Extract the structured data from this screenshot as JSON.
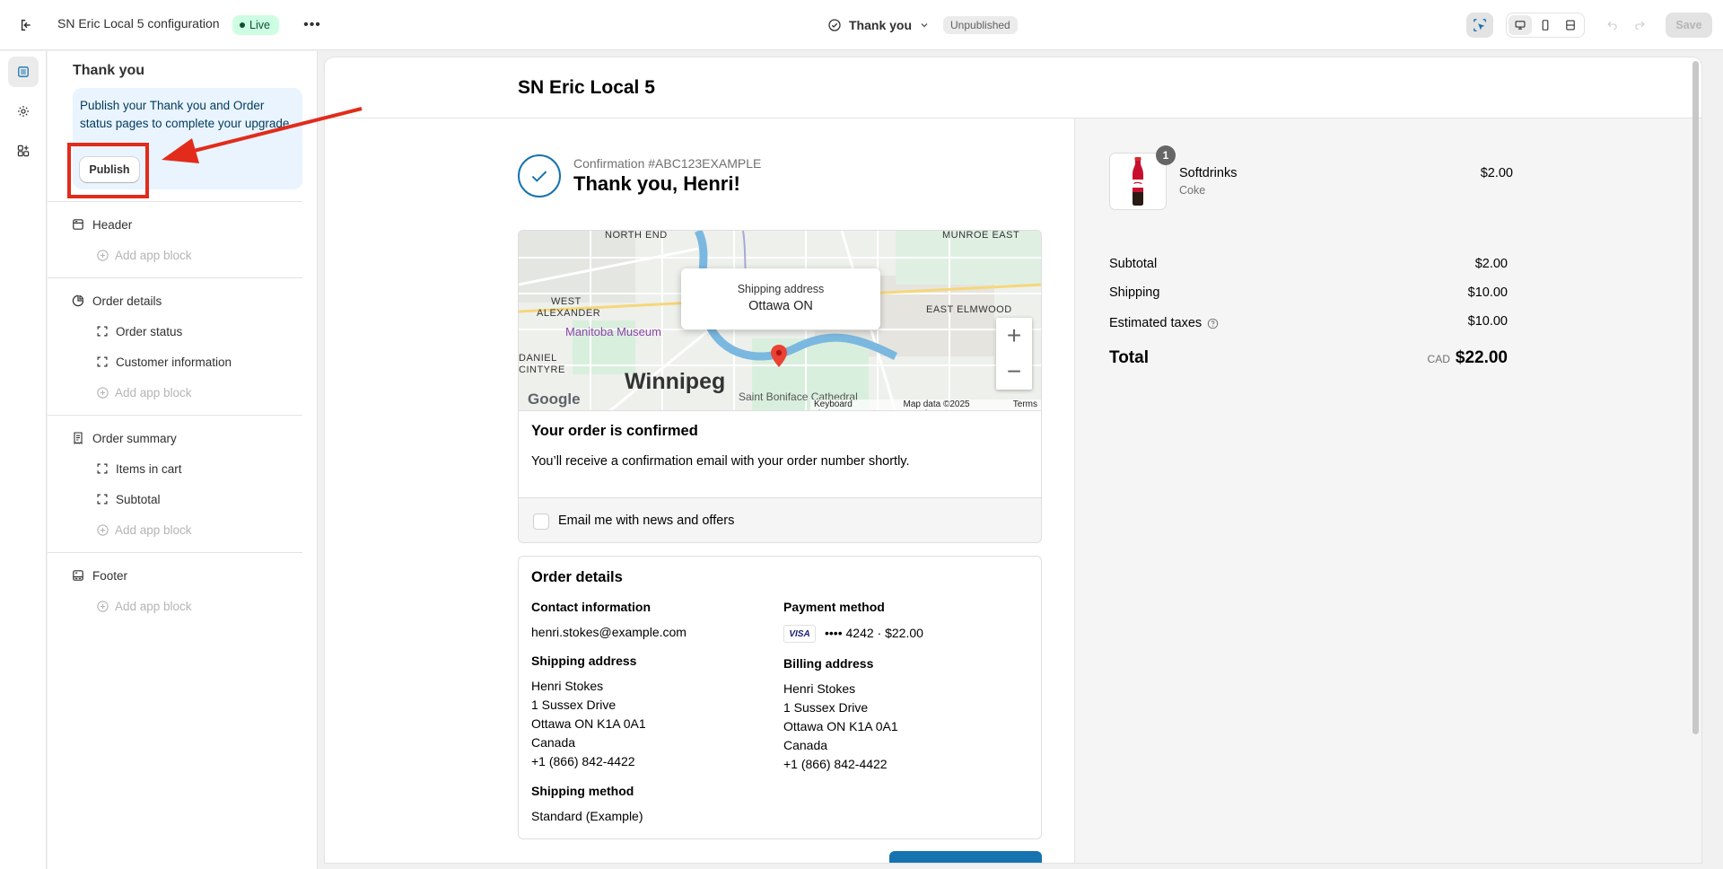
{
  "topbar": {
    "title": "SN Eric Local 5 configuration",
    "live_badge": "Live",
    "more_label": "•••",
    "page_selector": "Thank you",
    "status_badge": "Unpublished",
    "save_label": "Save"
  },
  "sidebar": {
    "title": "Thank you",
    "banner_text": "Publish your Thank you and Order status pages to complete your upgrade.",
    "publish_label": "Publish",
    "sections": [
      {
        "label": "Header",
        "items": [],
        "add_label": "Add app block"
      },
      {
        "label": "Order details",
        "items": [
          "Order status",
          "Customer information"
        ],
        "add_label": "Add app block"
      },
      {
        "label": "Order summary",
        "items": [
          "Items in cart",
          "Subtotal"
        ],
        "add_label": "Add app block"
      },
      {
        "label": "Footer",
        "items": [],
        "add_label": "Add app block"
      }
    ]
  },
  "preview": {
    "store_name": "SN Eric Local 5",
    "confirmation": "Confirmation #ABC123EXAMPLE",
    "thank_you": "Thank you, Henri!",
    "map": {
      "popup_label": "Shipping address",
      "popup_value": "Ottawa ON",
      "labels": [
        "NORTH END",
        "MUNROE EAST",
        "WEST",
        "ALEXANDER",
        "EAST ELMWOOD",
        "Manitoba Museum",
        "DANIEL",
        "CINTYRE",
        "Saint Boniface Cathedral"
      ],
      "city": "Winnipeg",
      "google": "Google",
      "footer": [
        "Keyboard shortcuts",
        "Map data ©2025 Google",
        "Terms"
      ]
    },
    "confirmed": {
      "heading": "Your order is confirmed",
      "text": "You’ll receive a confirmation email with your order number shortly.",
      "optin_label": "Email me with news and offers"
    },
    "details": {
      "heading": "Order details",
      "contact_label": "Contact information",
      "contact_email": "henri.stokes@example.com",
      "payment_label": "Payment method",
      "card_brand": "VISA",
      "payment_value": "•••• 4242 · $22.00",
      "shipping_label": "Shipping address",
      "shipping_lines": [
        "Henri Stokes",
        "1 Sussex Drive",
        "Ottawa ON K1A 0A1",
        "Canada",
        "+1 (866) 842-4422"
      ],
      "billing_label": "Billing address",
      "billing_lines": [
        "Henri Stokes",
        "1 Sussex Drive",
        "Ottawa ON K1A 0A1",
        "Canada",
        "+1 (866) 842-4422"
      ],
      "method_label": "Shipping method",
      "method_value": "Standard (Example)"
    },
    "summary": {
      "item_qty": "1",
      "item_name": "Softdrinks",
      "item_variant": "Coke",
      "item_price": "$2.00",
      "subtotal_label": "Subtotal",
      "subtotal_value": "$2.00",
      "shipping_label": "Shipping",
      "shipping_value": "$10.00",
      "taxes_label": "Estimated taxes",
      "taxes_value": "$10.00",
      "total_label": "Total",
      "currency": "CAD",
      "total_value": "$22.00"
    }
  },
  "colors": {
    "accent": "#1773b0",
    "annotation": "#e22b1b",
    "live_bg": "#cdfee1",
    "banner_bg": "#eaf4ff"
  }
}
